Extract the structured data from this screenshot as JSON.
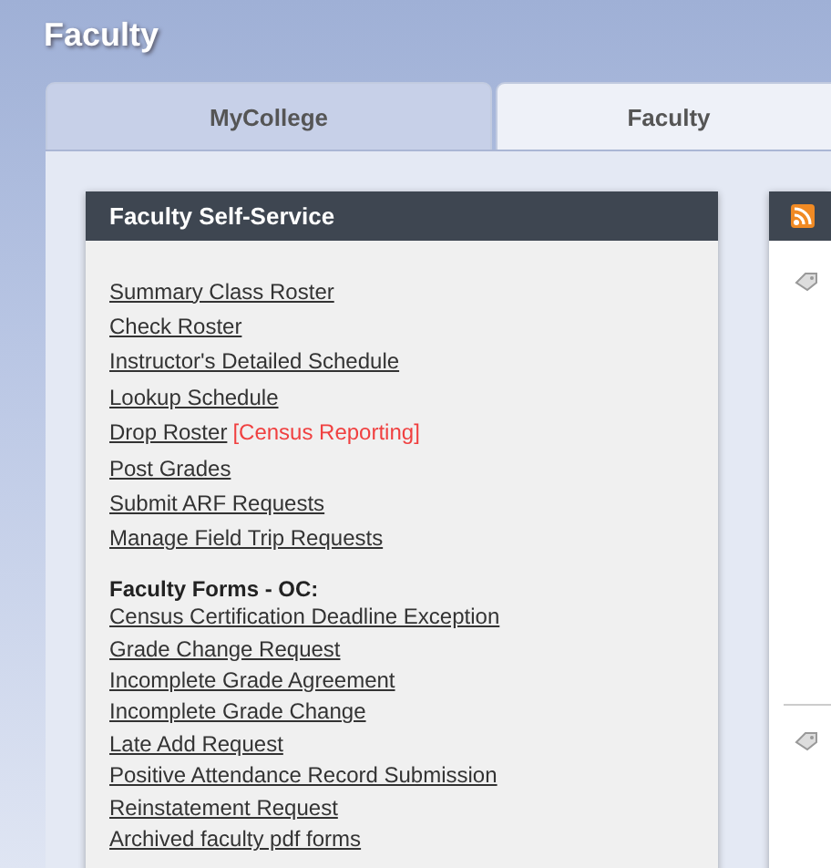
{
  "page_title": "Faculty",
  "tabs": [
    {
      "label": "MyCollege",
      "selected": false
    },
    {
      "label": "Faculty",
      "selected": true
    }
  ],
  "panel": {
    "title": "Faculty Self-Service",
    "links": [
      {
        "label": "Summary Class Roster"
      },
      {
        "label": "Check Roster"
      },
      {
        "label": "Instructor's Detailed Schedule"
      },
      {
        "label": "Lookup Schedule"
      },
      {
        "label": "Drop Roster",
        "note": "[Census Reporting]"
      },
      {
        "label": "Post Grades"
      },
      {
        "label": "Submit ARF Requests"
      },
      {
        "label": "Manage Field Trip Requests"
      }
    ],
    "forms_heading": "Faculty Forms - OC:",
    "form_links": [
      "Census Certification Deadline Exception",
      "Grade Change Request",
      "Incomplete Grade Agreement",
      "Incomplete Grade Change",
      "Late Add Request",
      "Positive Attendance Record Submission",
      "Reinstatement Request",
      "Archived faculty pdf forms"
    ]
  }
}
